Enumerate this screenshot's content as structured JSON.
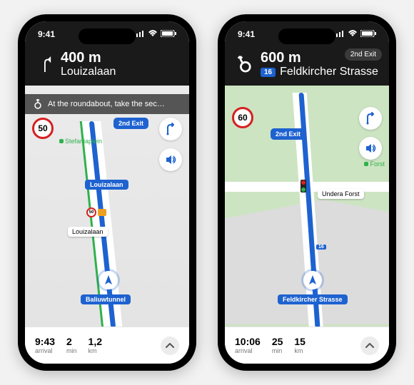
{
  "status": {
    "time": "9:41"
  },
  "left": {
    "banner": {
      "distance": "400 m",
      "street": "Louizalaan"
    },
    "sub_banner": "At the roundabout, take the sec…",
    "speed_limit": "50",
    "exit_badge": "2nd Exit",
    "poi": {
      "stefania": "Stefaniaplein"
    },
    "labels": {
      "louizalaan": "Louizalaan",
      "baliuwtunnel": "Baliuwtunnel"
    },
    "mini_speed": "50",
    "bottom": {
      "arrival": "9:43",
      "arrival_lbl": "arrival",
      "min": "2",
      "min_lbl": "min",
      "km": "1,2",
      "km_lbl": "km"
    }
  },
  "right": {
    "banner": {
      "distance": "600 m",
      "shield": "16",
      "street": "Feldkircher Strasse",
      "exit_pill": "2nd Exit"
    },
    "speed_limit": "60",
    "exit_badge": "2nd Exit",
    "labels": {
      "undera": "Undera Forst",
      "forst": "Forst",
      "feldkircher": "Feldkircher Strasse"
    },
    "shield_mini": "16",
    "bottom": {
      "arrival": "10:06",
      "arrival_lbl": "arrival",
      "min": "25",
      "min_lbl": "min",
      "km": "15",
      "km_lbl": "km"
    }
  }
}
